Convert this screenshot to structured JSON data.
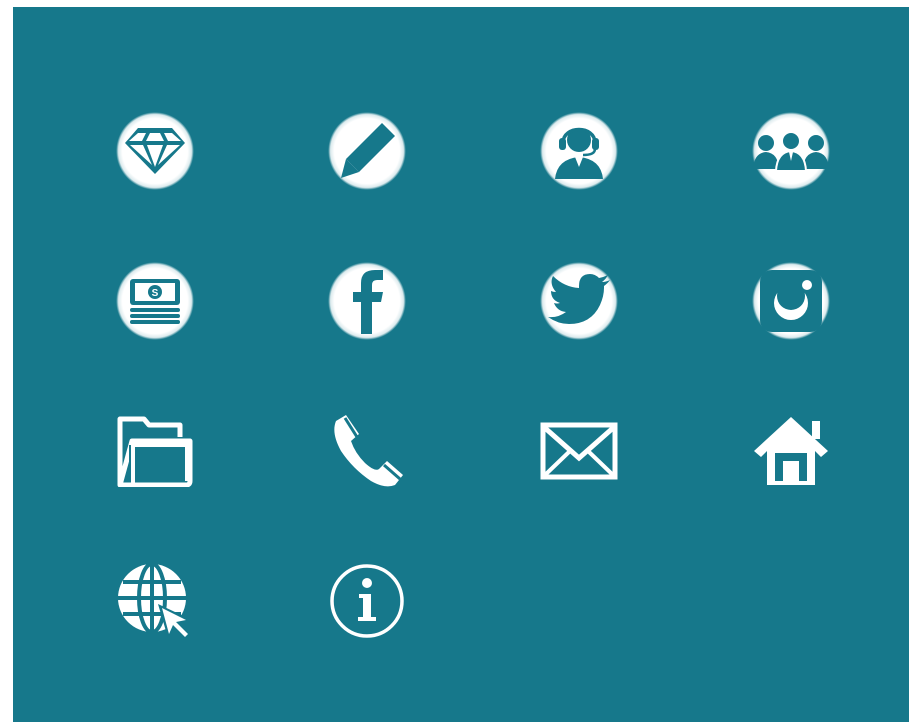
{
  "theme": {
    "background": "#16788b",
    "icon_on_badge": "#16788b",
    "icon_plain": "#ffffff",
    "badge": "#ffffff"
  },
  "icons": [
    {
      "name": "diamond-icon",
      "style": "badge"
    },
    {
      "name": "pencil-icon",
      "style": "badge"
    },
    {
      "name": "support-agent-icon",
      "style": "badge"
    },
    {
      "name": "team-icon",
      "style": "badge"
    },
    {
      "name": "money-stack-icon",
      "style": "badge"
    },
    {
      "name": "facebook-icon",
      "style": "badge"
    },
    {
      "name": "twitter-icon",
      "style": "badge"
    },
    {
      "name": "instagram-icon",
      "style": "badge"
    },
    {
      "name": "folder-icon",
      "style": "plain"
    },
    {
      "name": "phone-icon",
      "style": "plain"
    },
    {
      "name": "envelope-icon",
      "style": "plain"
    },
    {
      "name": "home-icon",
      "style": "plain"
    },
    {
      "name": "web-cursor-icon",
      "style": "plain"
    },
    {
      "name": "info-icon",
      "style": "plain"
    }
  ]
}
